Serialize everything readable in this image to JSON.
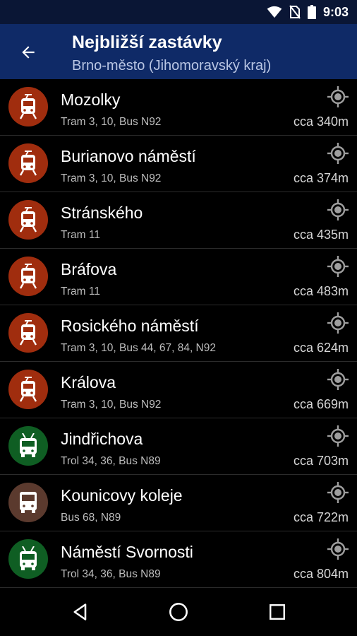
{
  "status_bar": {
    "time": "9:03",
    "icons": [
      "wifi-icon",
      "no-sim-icon",
      "battery-icon"
    ]
  },
  "app_bar": {
    "title": "Nejbližší zastávky",
    "subtitle": "Brno-město (Jihomoravský kraj)",
    "back_icon": "arrow-back-icon"
  },
  "colors": {
    "tram": "#a02d0e",
    "trolleybus": "#0f5e23",
    "bus": "#5b3a2e",
    "app_bar": "#0f2a67",
    "status_bar": "#0a1635"
  },
  "stops": [
    {
      "name": "Mozolky",
      "lines": "Tram 3, 10, Bus N92",
      "distance": "cca 340m",
      "type": "tram"
    },
    {
      "name": "Burianovo náměstí",
      "lines": "Tram 3, 10, Bus N92",
      "distance": "cca 374m",
      "type": "tram"
    },
    {
      "name": "Stránského",
      "lines": "Tram 11",
      "distance": "cca 435m",
      "type": "tram"
    },
    {
      "name": "Bráfova",
      "lines": "Tram 11",
      "distance": "cca 483m",
      "type": "tram"
    },
    {
      "name": "Rosického náměstí",
      "lines": "Tram 3, 10, Bus 44, 67, 84, N92",
      "distance": "cca 624m",
      "type": "tram"
    },
    {
      "name": "Králova",
      "lines": "Tram 3, 10, Bus N92",
      "distance": "cca 669m",
      "type": "tram"
    },
    {
      "name": "Jindřichova",
      "lines": "Trol 34, 36, Bus N89",
      "distance": "cca 703m",
      "type": "trolleybus"
    },
    {
      "name": "Kounicovy koleje",
      "lines": "Bus 68, N89",
      "distance": "cca 722m",
      "type": "bus"
    },
    {
      "name": "Náměstí Svornosti",
      "lines": "Trol 34, 36, Bus N89",
      "distance": "cca 804m",
      "type": "trolleybus"
    }
  ],
  "nav_bar": {
    "buttons": [
      "back-triangle-icon",
      "home-circle-icon",
      "recents-square-icon"
    ]
  }
}
